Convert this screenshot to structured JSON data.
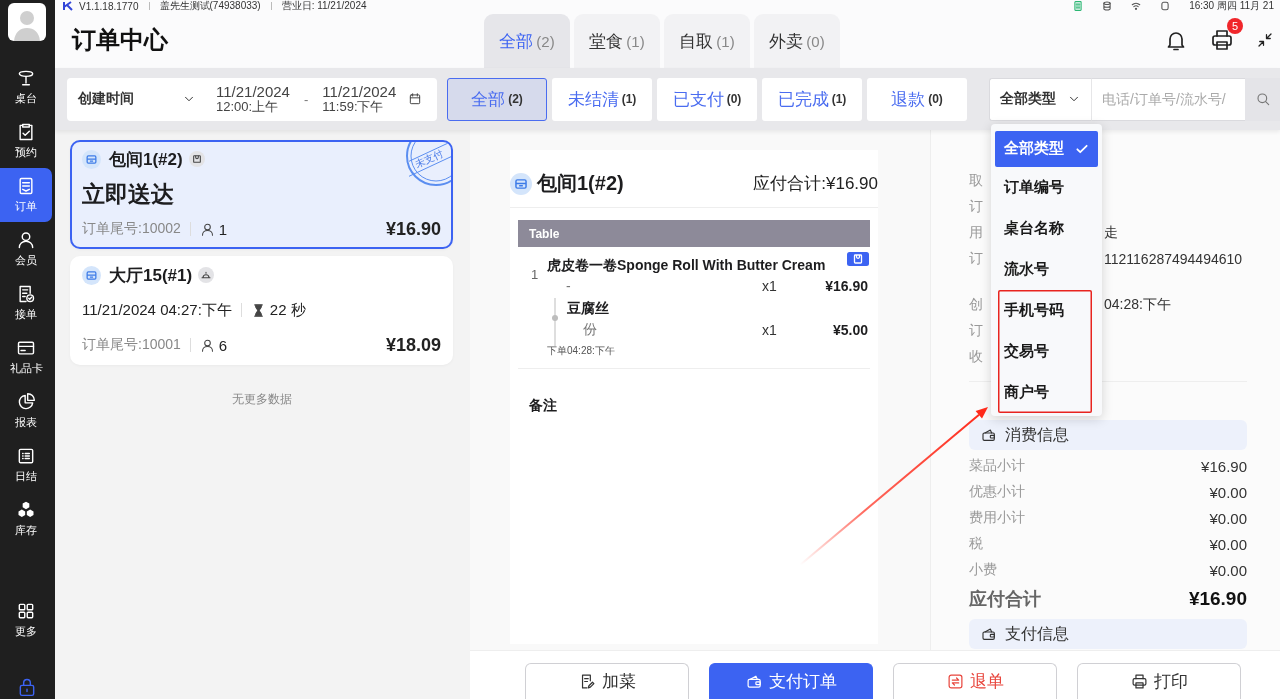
{
  "top_bar": {
    "version": "V1.1.18.1770",
    "store": "盖先生测试(74938033)",
    "business_day": "营业日: 11/21/2024",
    "clock": "16:30 周四 11月 21"
  },
  "sidebar": {
    "items": [
      {
        "label": "桌台",
        "selected": false
      },
      {
        "label": "预约",
        "selected": false
      },
      {
        "label": "订单",
        "selected": true
      },
      {
        "label": "会员",
        "selected": false
      },
      {
        "label": "接单",
        "selected": false
      },
      {
        "label": "礼品卡",
        "selected": false
      },
      {
        "label": "报表",
        "selected": false
      },
      {
        "label": "日结",
        "selected": false
      },
      {
        "label": "库存",
        "selected": false
      }
    ],
    "more": {
      "label": "更多"
    }
  },
  "header": {
    "title": "订单中心",
    "tabs": [
      {
        "label": "全部",
        "count": "(2)",
        "selected": true
      },
      {
        "label": "堂食",
        "count": "(1)",
        "selected": false
      },
      {
        "label": "自取",
        "count": "(1)",
        "selected": false
      },
      {
        "label": "外卖",
        "count": "(0)",
        "selected": false
      }
    ],
    "print_badge": "5"
  },
  "filters": {
    "date_field": "创建时间",
    "start": {
      "date": "11/21/2024",
      "time": "12:00:上午"
    },
    "separator": "-",
    "end": {
      "date": "11/21/2024",
      "time": "11:59:下午"
    },
    "status_tabs": [
      {
        "label": "全部",
        "count": "(2)",
        "selected": true
      },
      {
        "label": "未结清",
        "count": "(1)",
        "selected": false
      },
      {
        "label": "已支付",
        "count": "(0)",
        "selected": false
      },
      {
        "label": "已完成",
        "count": "(1)",
        "selected": false
      },
      {
        "label": "退款",
        "count": "(0)",
        "selected": false
      }
    ],
    "search": {
      "type": "全部类型",
      "placeholder": "电话/订单号/流水号/"
    }
  },
  "type_dropdown": {
    "options": [
      {
        "label": "全部类型",
        "selected": true,
        "marked": false
      },
      {
        "label": "订单编号",
        "selected": false,
        "marked": false
      },
      {
        "label": "桌台名称",
        "selected": false,
        "marked": false
      },
      {
        "label": "流水号",
        "selected": false,
        "marked": false
      },
      {
        "label": "手机号码",
        "selected": false,
        "marked": true
      },
      {
        "label": "交易号",
        "selected": false,
        "marked": true
      },
      {
        "label": "商户号",
        "selected": false,
        "marked": true
      }
    ]
  },
  "orders": {
    "cards": [
      {
        "table": "包间1(#2)",
        "kind": "takeout",
        "headline": "立即送达",
        "tail_no": "订单尾号:10002",
        "guests": "1",
        "total": "¥16.90",
        "stamp": "未支付",
        "selected": true
      },
      {
        "table": "大厅15(#1)",
        "kind": "dine_in",
        "created": "11/21/2024 04:27:下午",
        "elapsed": "22 秒",
        "tail_no": "订单尾号:10001",
        "guests": "6",
        "total": "¥18.09",
        "selected": false
      }
    ],
    "end_note": "无更多数据"
  },
  "detail": {
    "table": "包间1(#2)",
    "total": "应付合计:¥16.90",
    "section": "Table",
    "items": [
      {
        "index": "1",
        "name": "虎皮卷一卷Sponge Roll With Butter Cream",
        "spec": "-",
        "qty": "x1",
        "price": "¥16.90",
        "children": [
          {
            "name": "豆腐丝",
            "spec": "份",
            "qty": "x1",
            "price": "¥5.00"
          }
        ],
        "ordered_at": "下单04:28:下午"
      }
    ],
    "remark_label": "备注"
  },
  "info": {
    "groups": [
      {
        "rows": [
          {
            "label": "取"
          },
          {
            "label": "订"
          },
          {
            "label": "用",
            "value": "走"
          },
          {
            "label": "订",
            "value": "112116287494494610"
          }
        ]
      },
      {
        "rows": [
          {
            "label": "创",
            "value": "04:28:下午"
          },
          {
            "label": "订"
          },
          {
            "label": "收"
          }
        ]
      }
    ]
  },
  "consumption": {
    "title": "消费信息",
    "rows": [
      {
        "label": "菜品小计",
        "value": "¥16.90"
      },
      {
        "label": "优惠小计",
        "value": "¥0.00"
      },
      {
        "label": "费用小计",
        "value": "¥0.00"
      },
      {
        "label": "税",
        "value": "¥0.00"
      },
      {
        "label": "小费",
        "value": "¥0.00"
      }
    ],
    "total_label": "应付合计",
    "total_value": "¥16.90"
  },
  "payment": {
    "title": "支付信息"
  },
  "actions": [
    {
      "label": "加菜",
      "kind": "default"
    },
    {
      "label": "支付订单",
      "kind": "primary"
    },
    {
      "label": "退单",
      "kind": "danger"
    },
    {
      "label": "打印",
      "kind": "default"
    }
  ]
}
